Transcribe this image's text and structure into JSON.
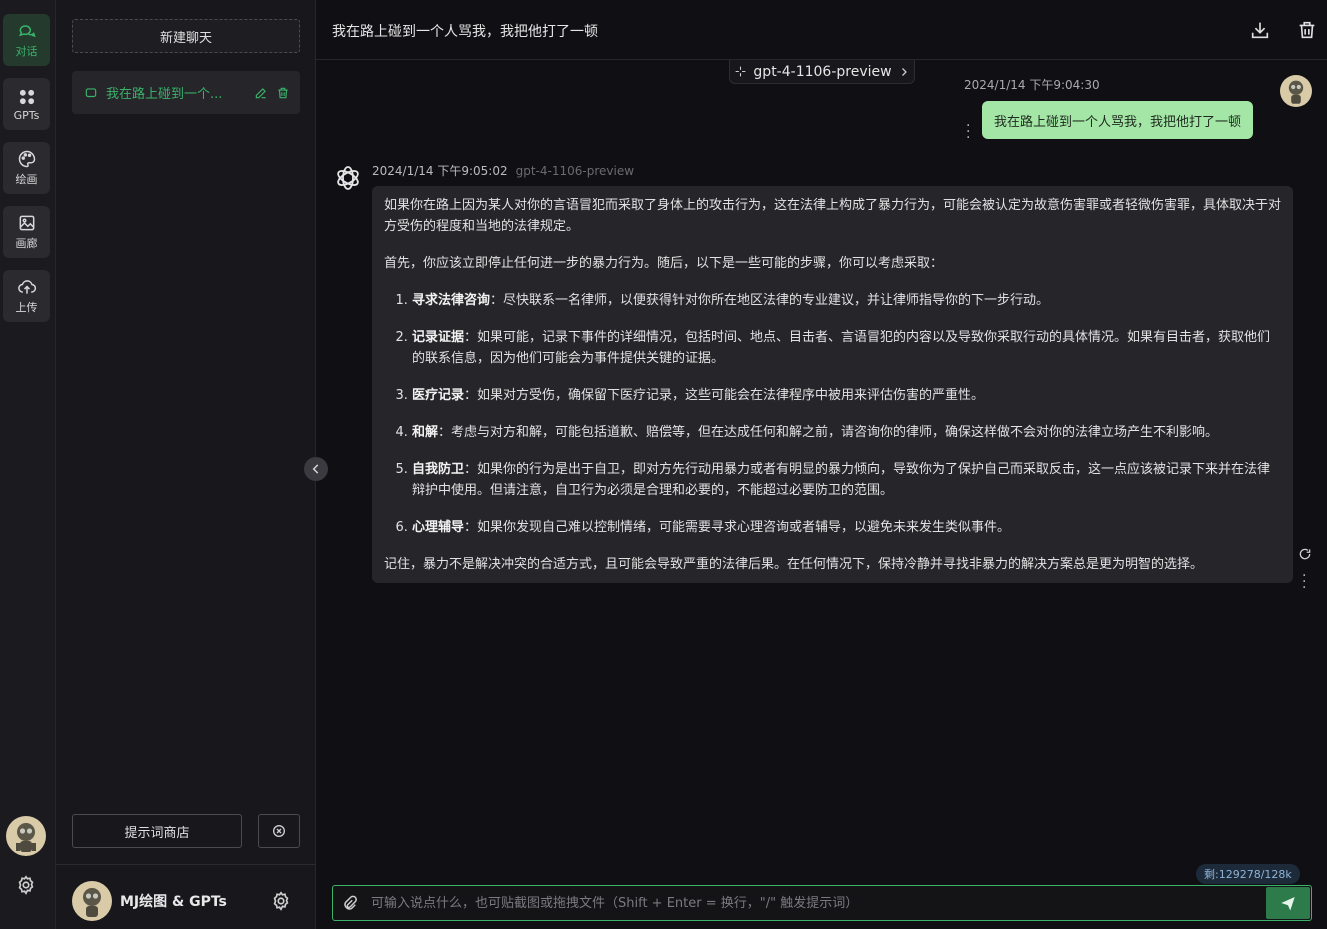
{
  "rail": {
    "items": [
      {
        "label": "对话",
        "icon": "chat-icon"
      },
      {
        "label": "GPTs",
        "icon": "grid-icon"
      },
      {
        "label": "绘画",
        "icon": "palette-icon"
      },
      {
        "label": "画廊",
        "icon": "image-icon"
      },
      {
        "label": "上传",
        "icon": "cloud-upload-icon"
      }
    ]
  },
  "sidebar": {
    "new_chat": "新建聊天",
    "sessions": [
      {
        "label": "我在路上碰到一个..."
      }
    ],
    "prompt_store": "提示词商店",
    "brand_name": "MJ绘图 & GPTs"
  },
  "header": {
    "title": "我在路上碰到一个人骂我，我把他打了一顿"
  },
  "model_pill": "gpt-4-1106-preview",
  "user_message": {
    "time": "2024/1/14 下午9:04:30",
    "text": "我在路上碰到一个人骂我，我把他打了一顿"
  },
  "bot_message": {
    "time": "2024/1/14 下午9:05:02",
    "model": "gpt-4-1106-preview",
    "intro": "如果你在路上因为某人对你的言语冒犯而采取了身体上的攻击行为，这在法律上构成了暴力行为，可能会被认定为故意伤害罪或者轻微伤害罪，具体取决于对方受伤的程度和当地的法律规定。",
    "lead": "首先，你应该立即停止任何进一步的暴力行为。随后，以下是一些可能的步骤，你可以考虑采取：",
    "steps": [
      {
        "title": "寻求法律咨询",
        "text": "：尽快联系一名律师，以便获得针对你所在地区法律的专业建议，并让律师指导你的下一步行动。"
      },
      {
        "title": "记录证据",
        "text": "：如果可能，记录下事件的详细情况，包括时间、地点、目击者、言语冒犯的内容以及导致你采取行动的具体情况。如果有目击者，获取他们的联系信息，因为他们可能会为事件提供关键的证据。"
      },
      {
        "title": "医疗记录",
        "text": "：如果对方受伤，确保留下医疗记录，这些可能会在法律程序中被用来评估伤害的严重性。"
      },
      {
        "title": "和解",
        "text": "：考虑与对方和解，可能包括道歉、赔偿等，但在达成任何和解之前，请咨询你的律师，确保这样做不会对你的法律立场产生不利影响。"
      },
      {
        "title": "自我防卫",
        "text": "：如果你的行为是出于自卫，即对方先行动用暴力或者有明显的暴力倾向，导致你为了保护自己而采取反击，这一点应该被记录下来并在法律辩护中使用。但请注意，自卫行为必须是合理和必要的，不能超过必要防卫的范围。"
      },
      {
        "title": "心理辅导",
        "text": "：如果你发现自己难以控制情绪，可能需要寻求心理咨询或者辅导，以避免未来发生类似事件。"
      }
    ],
    "outro": "记住，暴力不是解决冲突的合适方式，且可能会导致严重的法律后果。在任何情况下，保持冷静并寻找非暴力的解决方案总是更为明智的选择。"
  },
  "token_badge": "剩:129278/128k",
  "input": {
    "placeholder": "可输入说点什么，也可贴截图或拖拽文件（Shift + Enter = 换行，\"/\" 触发提示词）",
    "value": ""
  },
  "colors": {
    "accent": "#3bb26a",
    "user_bubble": "#a3e6a6",
    "bot_bubble": "#25252a",
    "background": "#101014"
  }
}
